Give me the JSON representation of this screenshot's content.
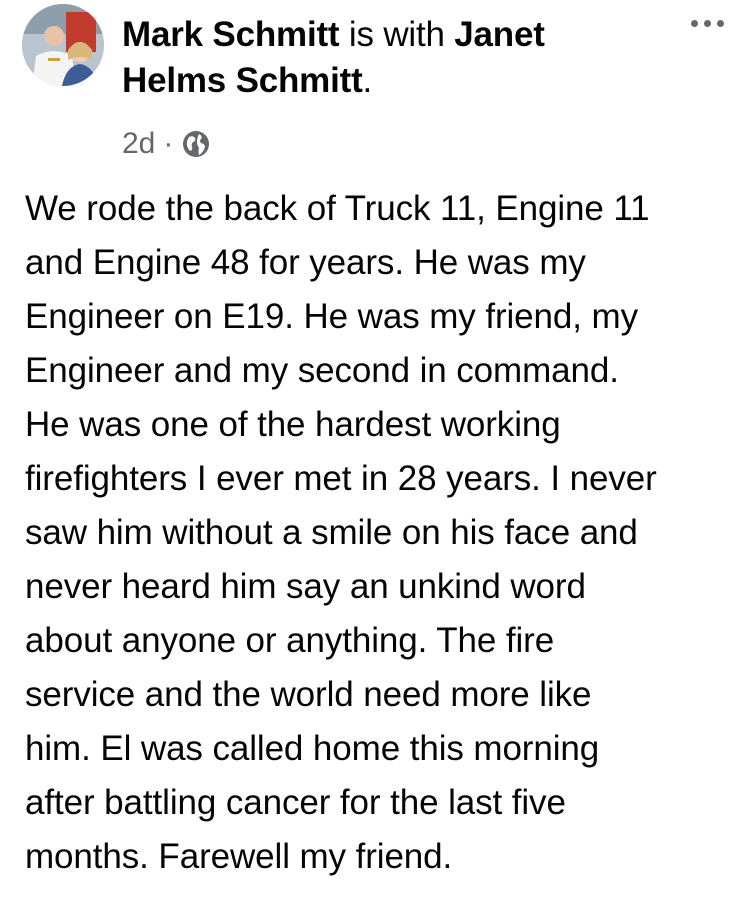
{
  "post": {
    "author_name": "Mark Schmitt",
    "with_text": " is with ",
    "tagged_name": "Janet Helms Schmitt",
    "tail_period": ".",
    "time": "2d",
    "separator": "·",
    "privacy_icon": "globe-icon",
    "more_icon": "more-options-icon",
    "avatar_icon": "profile-photo",
    "text": "We rode the back of Truck 11, Engine 11\nand Engine 48 for years. He was my\nEngineer on E19. He was my friend, my\nEngineer and my second in command.\nHe was one of the hardest working\nfirefighters I ever met in 28 years. I never\nsaw him without a smile on his face and\nnever heard him say an unkind word\nabout anyone or anything. The fire\nservice and the world need more like\nhim. El was called home this morning\nafter battling cancer for the last five\nmonths. Farewell my friend."
  },
  "colors": {
    "text": "#050505",
    "secondary": "#65676b",
    "background": "#ffffff"
  }
}
